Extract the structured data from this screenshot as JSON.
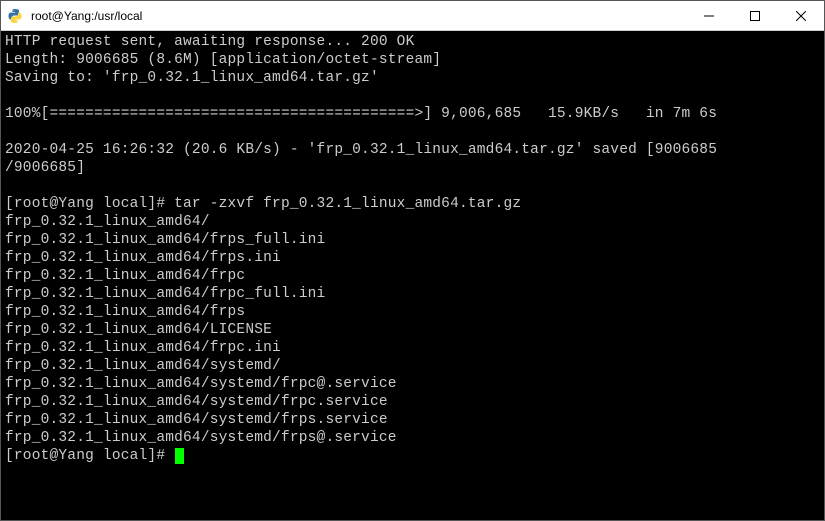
{
  "window": {
    "title": "root@Yang:/usr/local"
  },
  "terminal": {
    "lines": [
      "HTTP request sent, awaiting response... 200 OK",
      "Length: 9006685 (8.6M) [application/octet-stream]",
      "Saving to: 'frp_0.32.1_linux_amd64.tar.gz'",
      "",
      "100%[=========================================>] 9,006,685   15.9KB/s   in 7m 6s",
      "",
      "2020-04-25 16:26:32 (20.6 KB/s) - 'frp_0.32.1_linux_amd64.tar.gz' saved [9006685",
      "/9006685]",
      "",
      "[root@Yang local]# tar -zxvf frp_0.32.1_linux_amd64.tar.gz",
      "frp_0.32.1_linux_amd64/",
      "frp_0.32.1_linux_amd64/frps_full.ini",
      "frp_0.32.1_linux_amd64/frps.ini",
      "frp_0.32.1_linux_amd64/frpc",
      "frp_0.32.1_linux_amd64/frpc_full.ini",
      "frp_0.32.1_linux_amd64/frps",
      "frp_0.32.1_linux_amd64/LICENSE",
      "frp_0.32.1_linux_amd64/frpc.ini",
      "frp_0.32.1_linux_amd64/systemd/",
      "frp_0.32.1_linux_amd64/systemd/frpc@.service",
      "frp_0.32.1_linux_amd64/systemd/frpc.service",
      "frp_0.32.1_linux_amd64/systemd/frps.service",
      "frp_0.32.1_linux_amd64/systemd/frps@.service"
    ],
    "prompt": "[root@Yang local]# "
  }
}
